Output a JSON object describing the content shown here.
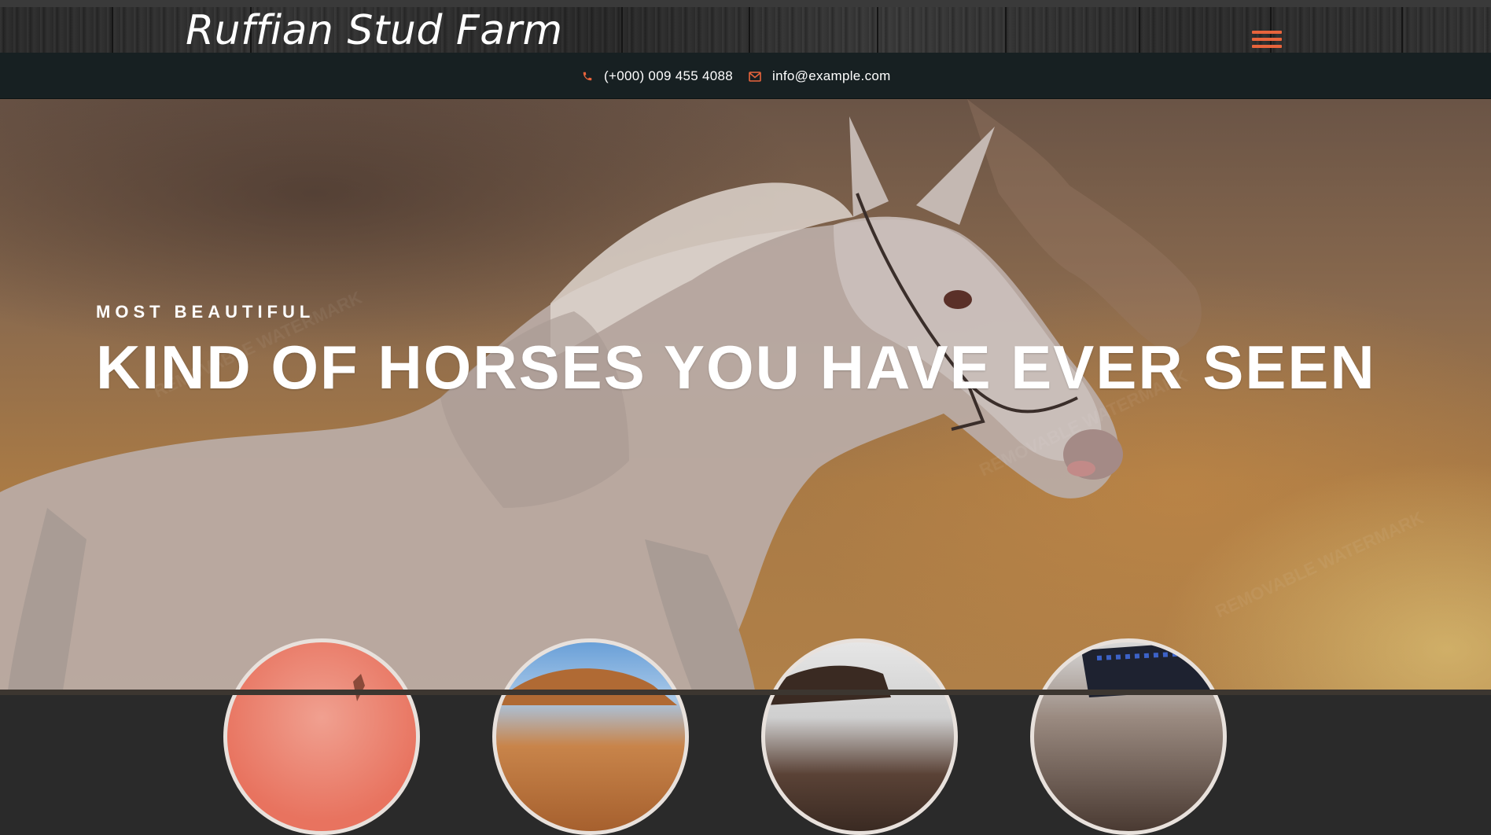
{
  "header": {
    "logo": "Ruffian Stud Farm",
    "menu_icon": "hamburger-menu-icon"
  },
  "contact": {
    "phone_icon": "phone-icon",
    "phone": "(+000) 009 455 4088",
    "email_icon": "envelope-icon",
    "email": "info@example.com"
  },
  "hero": {
    "subtitle": "MOST BEAUTIFUL",
    "title": "KIND OF HORSES YOU HAVE EVER SEEN",
    "image": "galloping-white-horse-photo"
  },
  "thumbnails": [
    {
      "name": "horse-thumbnail-1",
      "accent": "#e8735f"
    },
    {
      "name": "horse-thumbnail-2",
      "accent": "#5a8fcc"
    },
    {
      "name": "horse-thumbnail-3",
      "accent": "#d8d8d8"
    },
    {
      "name": "horse-thumbnail-4",
      "accent": "#2b3c8a"
    }
  ],
  "colors": {
    "accent": "#e8643c",
    "contact_bar": "#172022"
  }
}
